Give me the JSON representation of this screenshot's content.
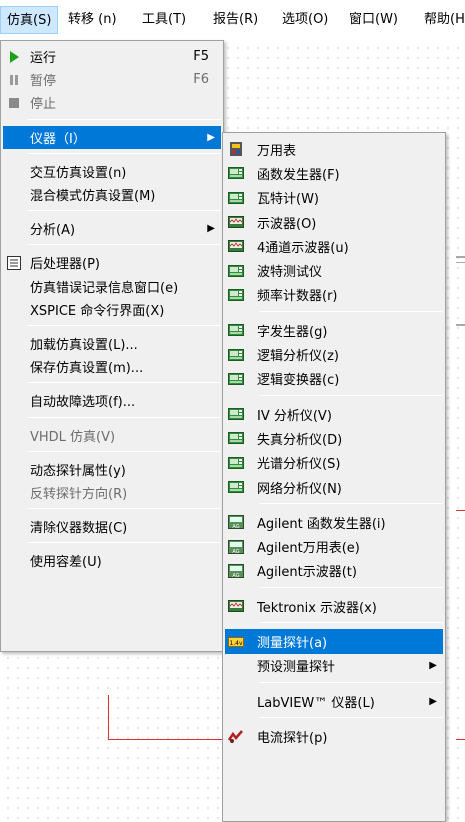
{
  "menubar": [
    {
      "label": "仿真(S)",
      "open": true
    },
    {
      "label": "转移 (n)"
    },
    {
      "label": "工具(T)"
    },
    {
      "label": "报告(R)"
    },
    {
      "label": "选项(O)"
    },
    {
      "label": "窗口(W)"
    },
    {
      "label": "帮助(H"
    }
  ],
  "simulate_menu": [
    {
      "label": "运行",
      "shortcut": "F5",
      "icon": "play-icon"
    },
    {
      "label": "暂停",
      "shortcut": "F6",
      "icon": "pause-icon",
      "disabled": true
    },
    {
      "label": "停止",
      "icon": "stop-icon",
      "disabled": true
    },
    {
      "separator": true
    },
    {
      "label": "仪器（I）",
      "submenu": true,
      "selected": true
    },
    {
      "separator": true
    },
    {
      "label": "交互仿真设置(n)"
    },
    {
      "label": "混合模式仿真设置(M)"
    },
    {
      "separator": true
    },
    {
      "label": "分析(A)",
      "submenu": true
    },
    {
      "separator": true
    },
    {
      "label": "后处理器(P)",
      "icon": "postprocessor-icon"
    },
    {
      "label": "仿真错误记录信息窗口(e)"
    },
    {
      "label": "XSPICE 命令行界面(X)"
    },
    {
      "separator": true
    },
    {
      "label": "加载仿真设置(L)..."
    },
    {
      "label": "保存仿真设置(m)..."
    },
    {
      "separator": true
    },
    {
      "label": "自动故障选项(f)..."
    },
    {
      "separator": true
    },
    {
      "label": "VHDL 仿真(V)",
      "disabled": true
    },
    {
      "separator": true
    },
    {
      "label": "动态探针属性(y)"
    },
    {
      "label": "反转探针方向(R)",
      "disabled": true
    },
    {
      "separator": true
    },
    {
      "label": "清除仪器数据(C)"
    },
    {
      "separator": true
    },
    {
      "label": "使用容差(U)"
    }
  ],
  "instruments_menu": [
    {
      "label": "万用表",
      "icon": "multimeter-icon"
    },
    {
      "label": "函数发生器(F)",
      "icon": "function-generator-icon"
    },
    {
      "label": "瓦特计(W)",
      "icon": "wattmeter-icon"
    },
    {
      "label": "示波器(O)",
      "icon": "oscilloscope-icon"
    },
    {
      "label": "4通道示波器(u)",
      "icon": "four-channel-oscilloscope-icon"
    },
    {
      "label": "波特测试仪",
      "icon": "bode-plotter-icon"
    },
    {
      "label": "频率计数器(r)",
      "icon": "frequency-counter-icon"
    },
    {
      "separator": true
    },
    {
      "label": "字发生器(g)",
      "icon": "word-generator-icon"
    },
    {
      "label": "逻辑分析仪(z)",
      "icon": "logic-analyzer-icon"
    },
    {
      "label": "逻辑变换器(c)",
      "icon": "logic-converter-icon"
    },
    {
      "separator": true
    },
    {
      "label": "IV 分析仪(V)",
      "icon": "iv-analyzer-icon"
    },
    {
      "label": "失真分析仪(D)",
      "icon": "distortion-analyzer-icon"
    },
    {
      "label": "光谱分析仪(S)",
      "icon": "spectrum-analyzer-icon"
    },
    {
      "label": "网络分析仪(N)",
      "icon": "network-analyzer-icon"
    },
    {
      "separator": true
    },
    {
      "label": "Agilent 函数发生器(i)",
      "icon": "agilent-function-generator-icon"
    },
    {
      "label": "Agilent万用表(e)",
      "icon": "agilent-multimeter-icon"
    },
    {
      "label": "Agilent示波器(t)",
      "icon": "agilent-oscilloscope-icon"
    },
    {
      "separator": true
    },
    {
      "label": "Tektronix 示波器(x)",
      "icon": "tektronix-oscilloscope-icon"
    },
    {
      "separator": true
    },
    {
      "label": "测量探针(a)",
      "icon": "measurement-probe-icon",
      "selected": true,
      "badge": "1.4v"
    },
    {
      "label": "预设测量探针",
      "submenu": true
    },
    {
      "separator": true
    },
    {
      "label": "LabVIEW™ 仪器(L)",
      "submenu": true
    },
    {
      "separator": true
    },
    {
      "label": "电流探针(p)",
      "icon": "current-probe-icon"
    }
  ],
  "colors": {
    "selection": "#0078d7",
    "menu_bg": "#f0f0f0",
    "wire": "#e0322c",
    "run_green": "#1aa31a"
  }
}
